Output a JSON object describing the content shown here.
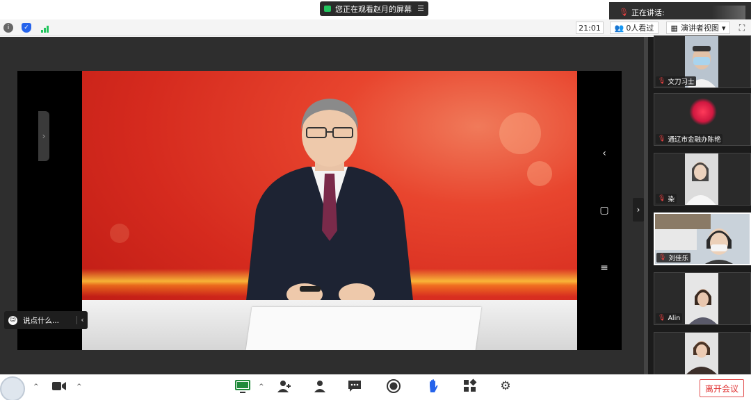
{
  "banner": {
    "share_text": "您正在观看赵月的屏幕",
    "speaking_label": "正在讲话:"
  },
  "topbar": {
    "time": "21:01",
    "viewers": "0人看过",
    "view_mode": "演讲者视图"
  },
  "chat": {
    "placeholder": "说点什么..."
  },
  "participants": [
    {
      "name": "文刀习士"
    },
    {
      "name": "通辽市金融办陈艳"
    },
    {
      "name": "染"
    },
    {
      "name": "刘佳乐"
    },
    {
      "name": "Alin"
    },
    {
      "name": ""
    }
  ],
  "bottombar": {
    "leave_label": "离开会议"
  },
  "colors": {
    "leave_red": "#e03030",
    "share_green": "#22c55e",
    "shield_blue": "#2563eb",
    "stage_dark": "#2e2e2e",
    "video_red": "#d52a1e"
  },
  "icons": [
    "info-icon",
    "shield-icon",
    "signal-icon",
    "viewers-icon",
    "view-layout-icon",
    "fullscreen-icon",
    "smile-icon",
    "mic-icon",
    "camera-icon",
    "share-screen-icon",
    "add-user-icon",
    "participants-icon",
    "chat-icon",
    "record-icon",
    "hand-icon",
    "apps-icon",
    "settings-icon"
  ]
}
